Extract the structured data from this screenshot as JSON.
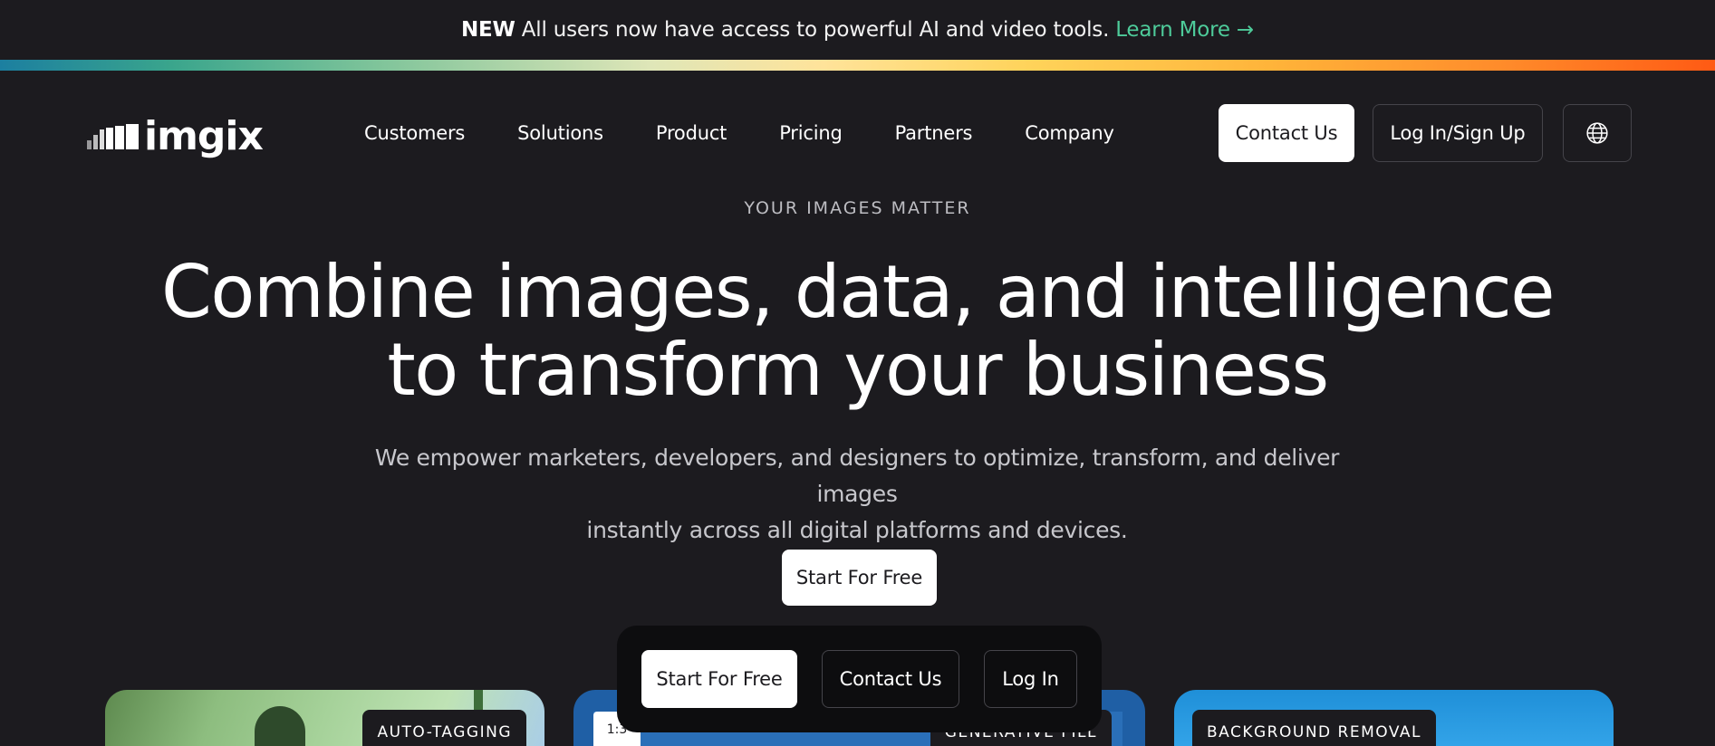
{
  "announcement": {
    "tag": "NEW",
    "message": "All users now have access to powerful AI and video tools.",
    "link": "Learn More →"
  },
  "brand": {
    "name": "imgix"
  },
  "nav": {
    "items": [
      {
        "label": "Customers"
      },
      {
        "label": "Solutions"
      },
      {
        "label": "Product"
      },
      {
        "label": "Pricing"
      },
      {
        "label": "Partners"
      },
      {
        "label": "Company"
      }
    ],
    "contact_label": "Contact Us",
    "login_label": "Log In/Sign Up",
    "globe_icon": "globe-icon"
  },
  "hero": {
    "eyebrow": "YOUR IMAGES MATTER",
    "headline_line1": "Combine images, data, and intelligence",
    "headline_line2": "to transform your business",
    "subtext_line1": "We empower marketers, developers, and designers to optimize, transform, and deliver images",
    "subtext_line2": "instantly across all digital platforms and devices.",
    "cta_label": "Start For Free"
  },
  "feature_cards": [
    {
      "label": "AUTO-TAGGING"
    },
    {
      "label": "GENERATIVE FILL",
      "ratio": "1:3"
    },
    {
      "label": "BACKGROUND REMOVAL"
    }
  ],
  "floating_bar": {
    "start_label": "Start For Free",
    "contact_label": "Contact Us",
    "login_label": "Log In"
  },
  "colors": {
    "background": "#1c1b1f",
    "accent_link": "#4ecb9a",
    "button_white": "#ffffff"
  }
}
